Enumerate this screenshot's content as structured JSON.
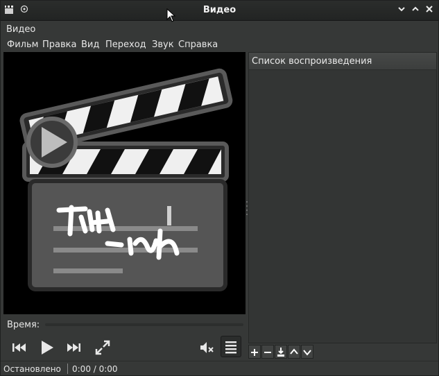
{
  "window": {
    "title": "Видео"
  },
  "app_label": "Видео",
  "menu": [
    "Фильм",
    "Правка",
    "Вид",
    "Переход",
    "Звук",
    "Справка"
  ],
  "playlist": {
    "header": "Список воспроизведения"
  },
  "time": {
    "label": "Время:"
  },
  "status": {
    "state": "Остановлено",
    "time": "0:00 / 0:00"
  },
  "colors": {
    "accent": "#ffffff",
    "background": "#363837"
  }
}
